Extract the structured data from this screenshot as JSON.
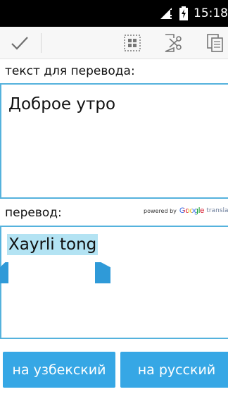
{
  "status_bar": {
    "time": "15:18"
  },
  "action_bar": {
    "icons": [
      "checkmark-icon",
      "select-all-icon",
      "cut-icon",
      "copy-icon"
    ]
  },
  "source": {
    "label": "текст для перевода:",
    "text": "Доброе утро"
  },
  "result": {
    "label": "перевод:",
    "text": "Xayrli tong"
  },
  "powered_by": {
    "prefix": "powered by",
    "brand": "Google",
    "suffix": "translate"
  },
  "buttons": {
    "to_uzbek": "на узбекский",
    "to_russian": "на русский"
  },
  "colors": {
    "accent": "#36a7e5",
    "border": "#55b2dd",
    "selection": "#b3e3f3"
  }
}
